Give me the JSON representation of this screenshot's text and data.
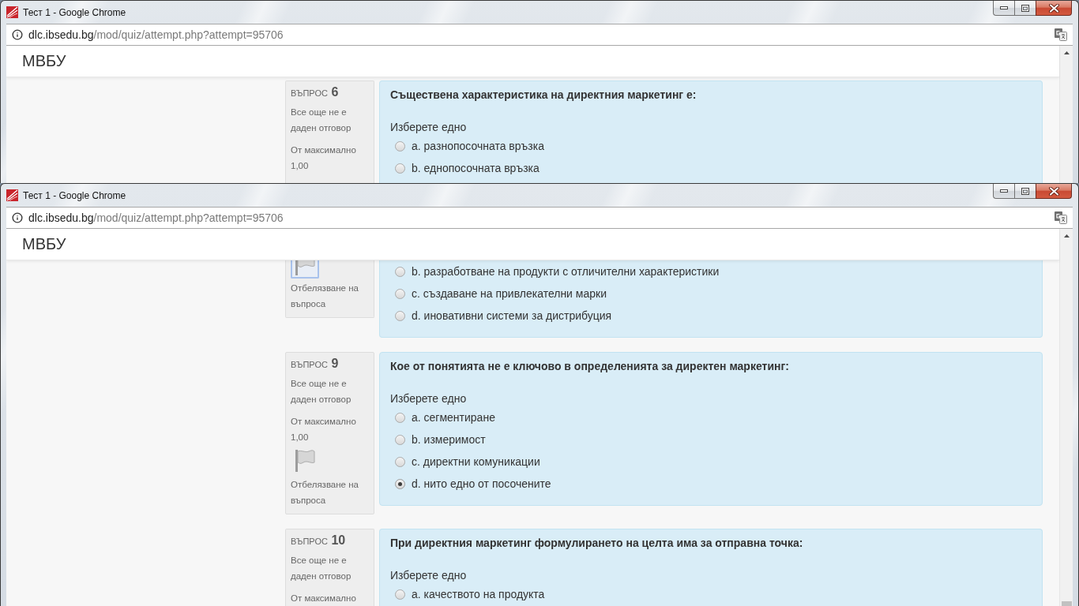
{
  "windows": [
    {
      "title": "Тест 1 - Google Chrome",
      "address": {
        "domain": "dlc.ibsedu.bg",
        "path": "/mod/quiz/attempt.php?attempt=95706"
      },
      "site_name": "МВБУ",
      "questions": [
        {
          "info": {
            "label": "ВЪПРОС",
            "number": "6",
            "status": "Все още не е даден отговор",
            "mark": "От максимално 1,00"
          },
          "text": "Съществена характеристика на директния маркетинг е:",
          "prompt": "Изберете едно",
          "options": [
            {
              "label": "a. разнопосочната връзка",
              "selected": false
            },
            {
              "label": "b. еднопосочната връзка",
              "selected": false
            }
          ]
        }
      ]
    },
    {
      "title": "Тест 1 - Google Chrome",
      "address": {
        "domain": "dlc.ibsedu.bg",
        "path": "/mod/quiz/attempt.php?attempt=95706"
      },
      "site_name": "МВБУ",
      "questions": [
        {
          "info": {
            "flag": {
              "label": "Отбелязване на въпроса",
              "focused": true
            }
          },
          "options": [
            {
              "label": "b. разработване на продукти с отличителни характеристики",
              "selected": false
            },
            {
              "label": "c. създаване на привлекателни марки",
              "selected": false
            },
            {
              "label": "d. иновативни системи за дистрибуция",
              "selected": false
            }
          ]
        },
        {
          "info": {
            "label": "ВЪПРОС",
            "number": "9",
            "status": "Все още не е даден отговор",
            "mark": "От максимално 1,00",
            "flag": {
              "label": "Отбелязване на въпроса",
              "focused": false
            }
          },
          "text": "Кое от понятията не е ключово в определенията за директен маркетинг:",
          "prompt": "Изберете едно",
          "options": [
            {
              "label": "a. сегментиране",
              "selected": false
            },
            {
              "label": "b. измеримост",
              "selected": false
            },
            {
              "label": "c. директни комуникации",
              "selected": false
            },
            {
              "label": "d. нито едно от посочените",
              "selected": true
            }
          ]
        },
        {
          "info": {
            "label": "ВЪПРОС",
            "number": "10",
            "status": "Все още не е даден отговор",
            "mark": "От максимално"
          },
          "text": "При директния маркетинг формулирането на целта има за отправна точка:",
          "prompt": "Изберете едно",
          "options": [
            {
              "label": "а. качеството на продукта",
              "selected": false
            }
          ]
        }
      ]
    }
  ]
}
